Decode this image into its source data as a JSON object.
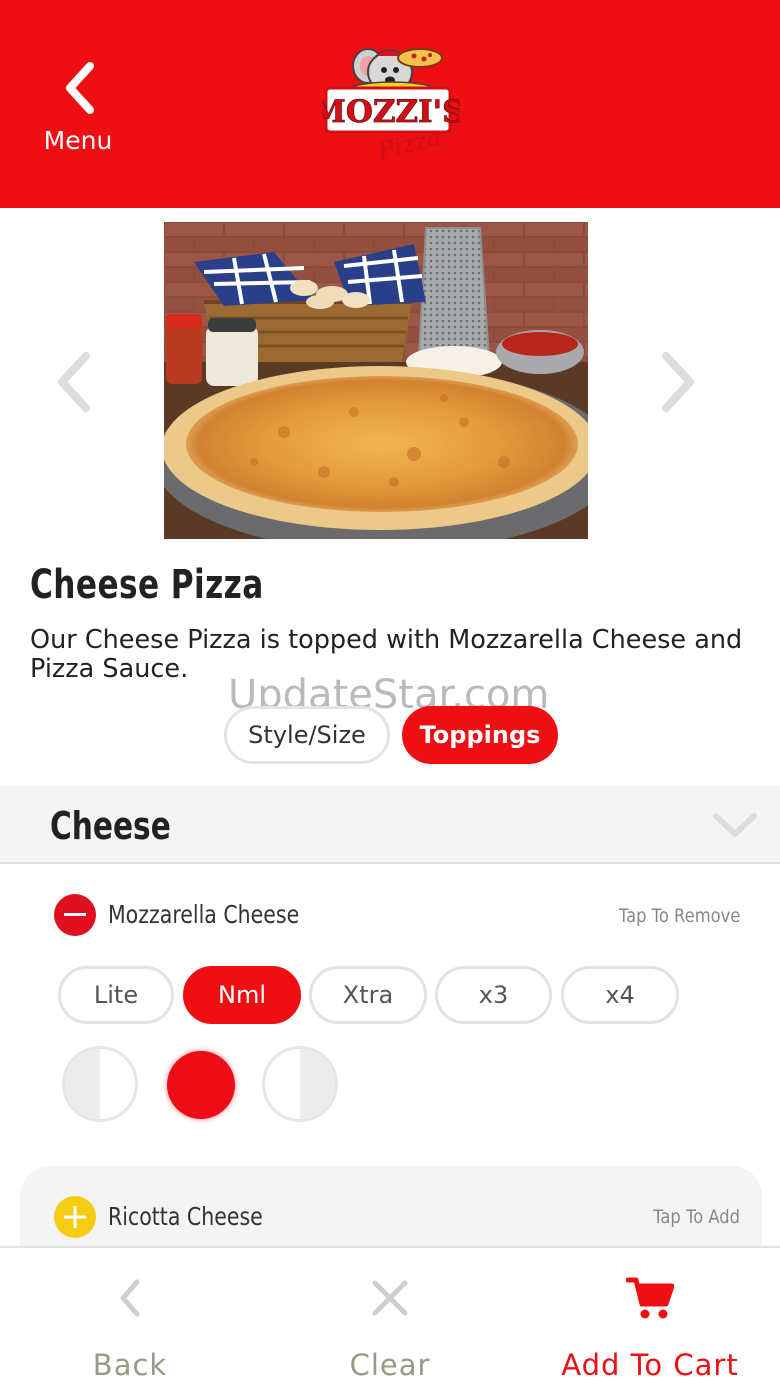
{
  "header": {
    "back_label": "Menu",
    "logo_text": "MOZZI'S",
    "logo_subtext": "Pizza"
  },
  "product": {
    "title": "Cheese Pizza",
    "description": "Our Cheese Pizza is topped with Mozzarella Cheese and Pizza Sauce."
  },
  "watermark": "UpdateStar.com",
  "tabs": [
    {
      "label": "Style/Size",
      "selected": false
    },
    {
      "label": "Toppings",
      "selected": true
    }
  ],
  "section": {
    "title": "Cheese"
  },
  "toppings": [
    {
      "name": "Mozzarella Cheese",
      "hint": "Tap To Remove",
      "amounts": [
        "Lite",
        "Nml",
        "Xtra",
        "x3",
        "x4"
      ],
      "selected_amount": "Nml",
      "portions": [
        "left-half",
        "whole",
        "right-half"
      ],
      "selected_portion": "whole"
    },
    {
      "name": "Ricotta Cheese",
      "hint": "Tap To Add"
    }
  ],
  "bottom_bar": {
    "back": "Back",
    "clear": "Clear",
    "add_to_cart": "Add To Cart"
  },
  "colors": {
    "brand_red": "#ee0f12",
    "muted_olive": "#9a9a84",
    "topping_add_yellow": "#f5cc14"
  }
}
